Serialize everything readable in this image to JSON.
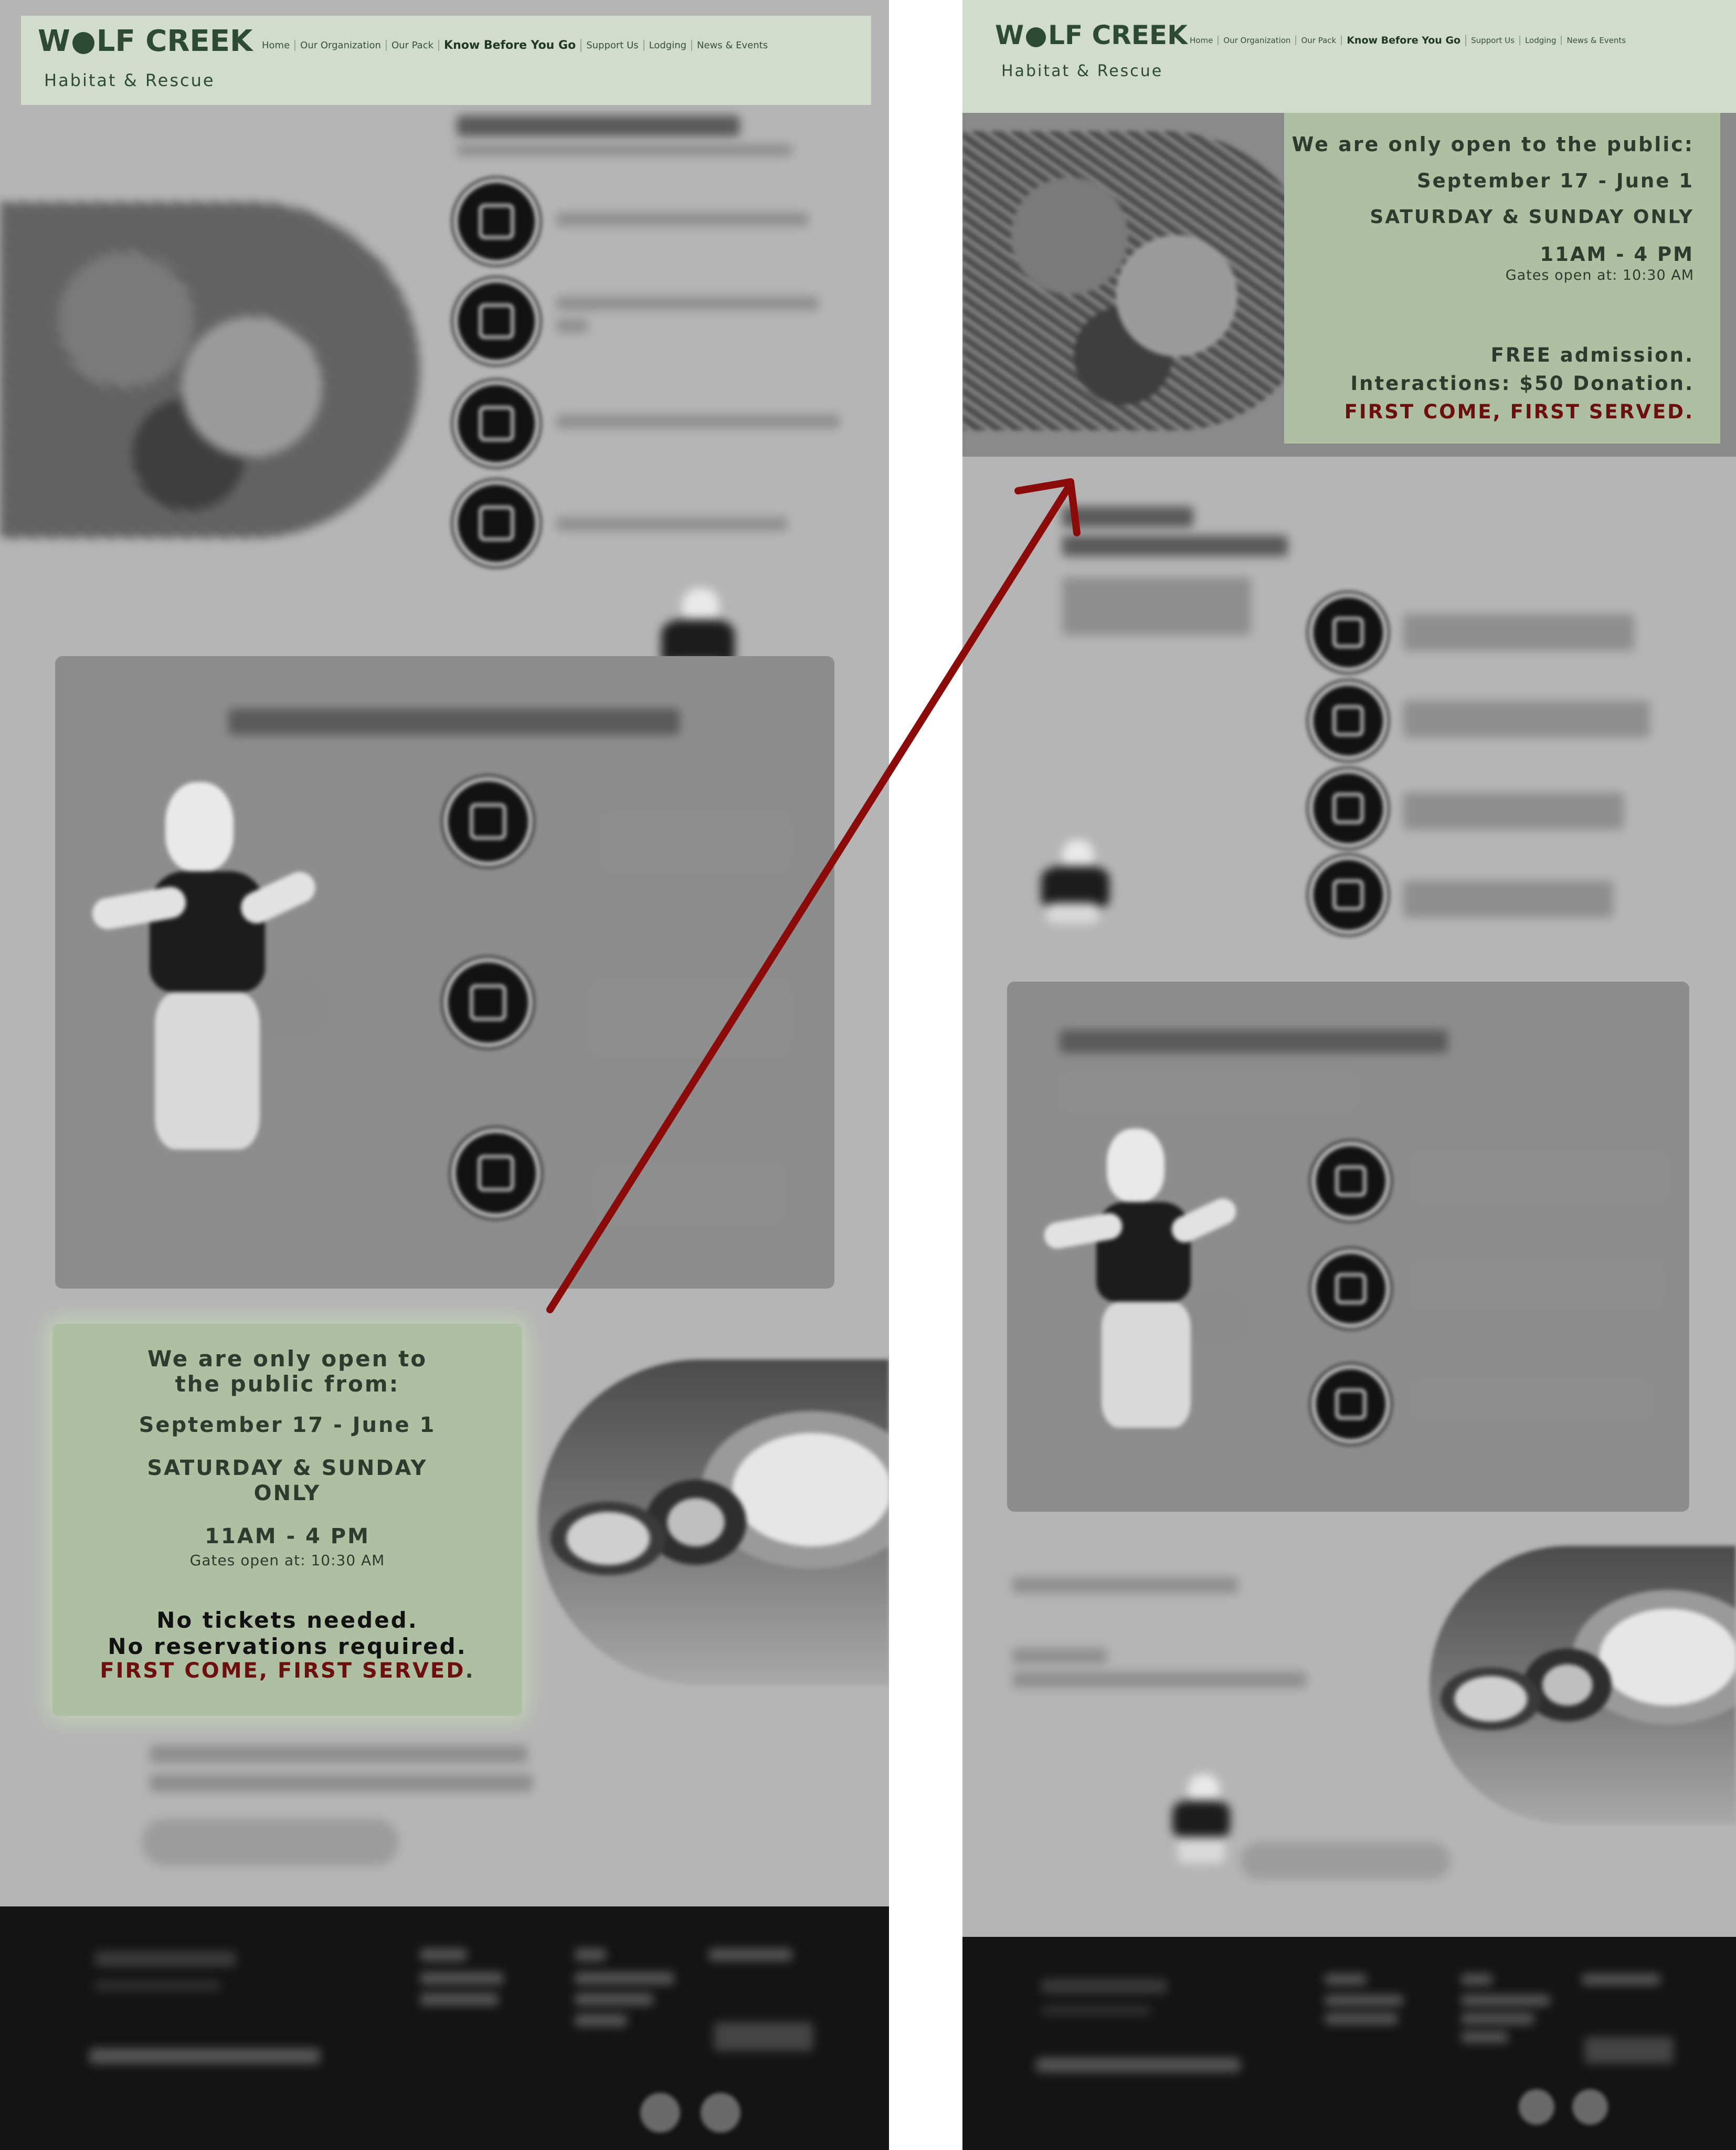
{
  "site": {
    "logo_w": "W",
    "logo_rest": "LF CREEK",
    "tagline": "Habitat & Rescue",
    "nav": [
      "Home",
      "Our Organization",
      "Our Pack",
      "Know Before You Go",
      "Support Us",
      "Lodging",
      "News & Events"
    ],
    "nav_active_index": 3
  },
  "left": {
    "hours_box": {
      "line1": "We are only open to",
      "line2": "the public from:",
      "dates": "September 17 - June 1",
      "days1": "SATURDAY & SUNDAY",
      "days2": "ONLY",
      "time": "11AM - 4 PM",
      "gates": "Gates open at: 10:30 AM",
      "no_tickets": "No tickets needed.",
      "no_res": "No reservations required.",
      "fcfs": "FIRST COME, FIRST SERVED",
      "fcfs_end": "."
    }
  },
  "right": {
    "hours_box": {
      "line1": "We are only open to the public:",
      "dates": "September 17 - June 1",
      "days": "SATURDAY & SUNDAY ONLY",
      "time": "11AM - 4 PM",
      "gates": "Gates open at: 10:30 AM",
      "free": "FREE admission.",
      "interactions": "Interactions: $50 Donation.",
      "fcfs": "FIRST COME, FIRST SERVED",
      "fcfs_end": "."
    }
  },
  "colors": {
    "header_bg": "#d2dccc",
    "brand_green": "#2d4a36",
    "hours_box_bg": "#aebfa2",
    "accent_red": "#6b0f0f",
    "footer_bg": "#141414",
    "annotation_arrow": "#8b0a0a"
  }
}
